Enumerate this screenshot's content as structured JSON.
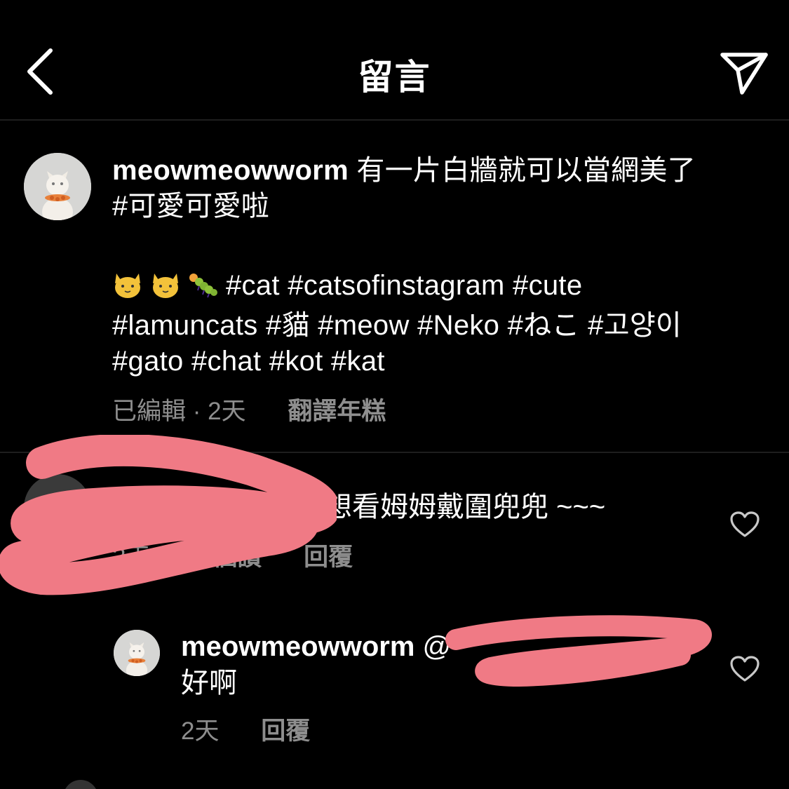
{
  "header": {
    "back_icon": "chevron-left-icon",
    "title": "留言",
    "share_icon": "paper-plane-icon"
  },
  "caption": {
    "username": "meowmeowworm",
    "text_line1": " 有一片白牆就可以當網美了",
    "text_line2": "#可愛可愛啦",
    "emojis": [
      "cat-face-emoji",
      "cat-face-emoji",
      "bug-emoji"
    ],
    "tags_line1": "#cat #catsofinstagram #cute",
    "tags_line2": "#lamuncats #貓  #meow #Neko #ねこ #고양이",
    "tags_line3": "#gato #chat #kot #kat",
    "edited": "已編輯 · 2天",
    "translate": "翻譯年糕"
  },
  "comment": {
    "text": "想看姆姆戴圍兜兜 ~~~",
    "time": "2天",
    "likes": "1 個讚",
    "reply": "回覆"
  },
  "reply": {
    "username": "meowmeowworm",
    "mention_prefix": " @",
    "text": "好啊",
    "time": "2天",
    "reply": "回覆"
  },
  "colors": {
    "background": "#000000",
    "text": "#ffffff",
    "secondary_text": "#8e8e8e",
    "redaction": "#f07a85"
  }
}
